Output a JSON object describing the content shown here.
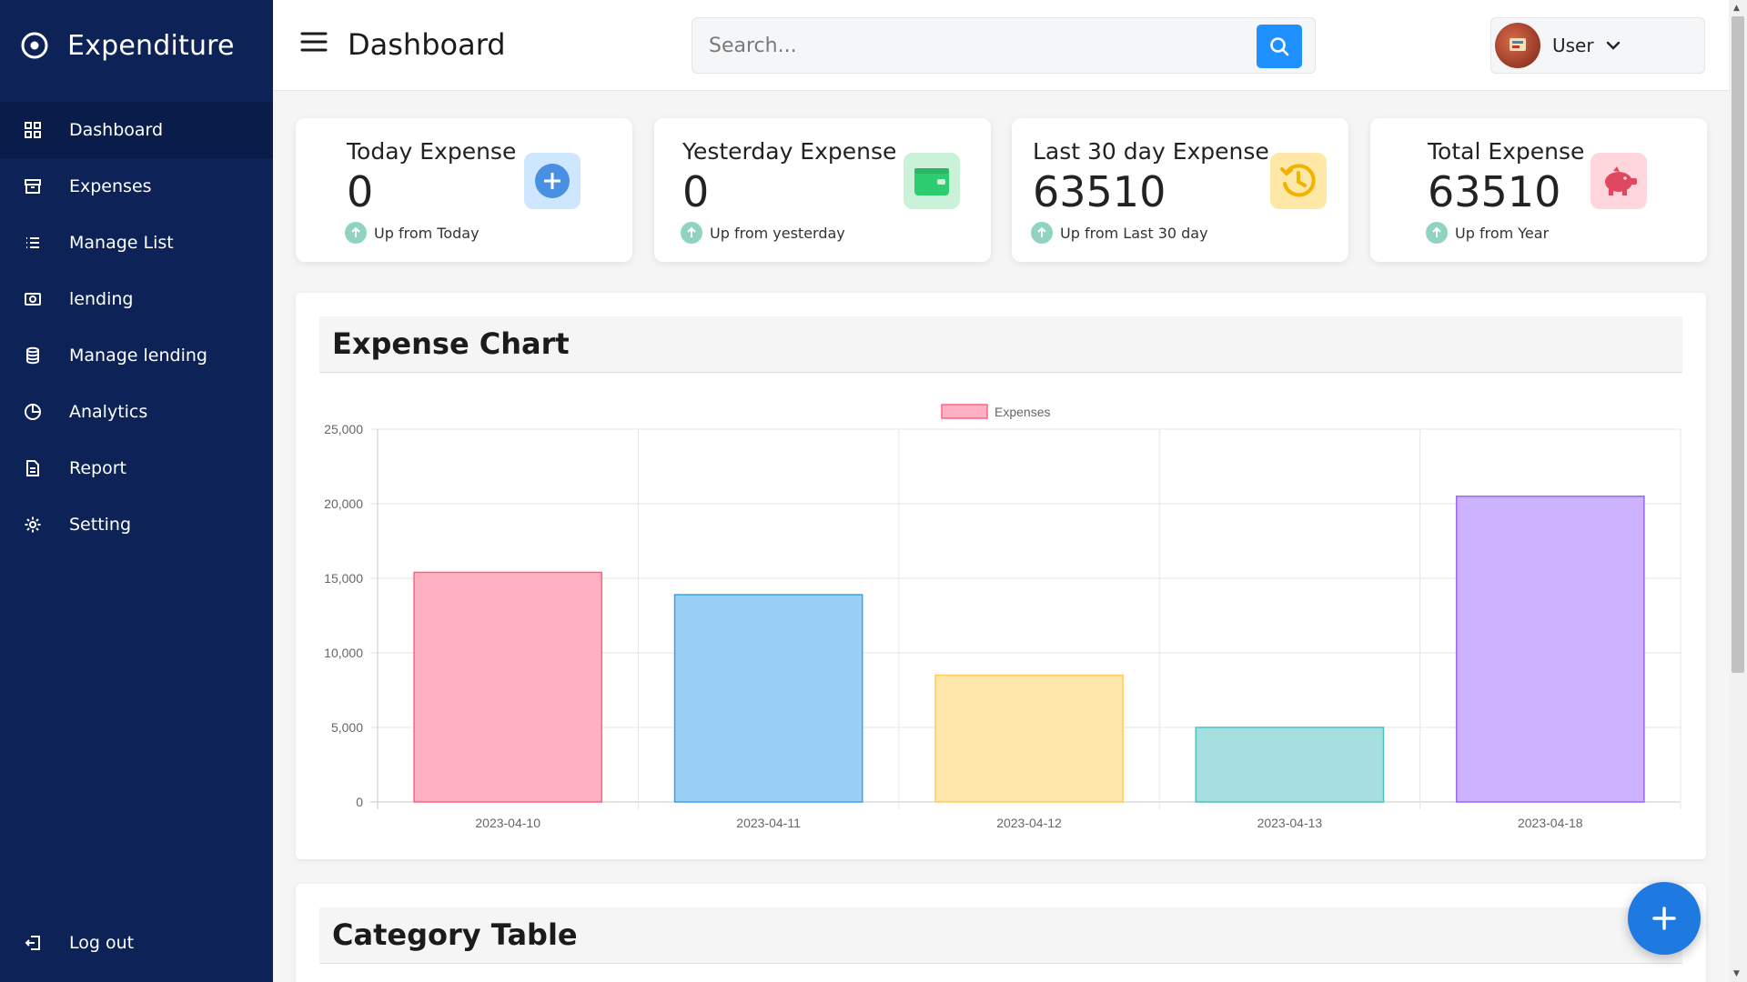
{
  "app": {
    "brand": "Expenditure"
  },
  "sidebar": {
    "items": [
      {
        "label": "Dashboard",
        "icon": "grid-icon",
        "active": true
      },
      {
        "label": "Expenses",
        "icon": "archive-icon"
      },
      {
        "label": "Manage List",
        "icon": "list-icon"
      },
      {
        "label": "lending",
        "icon": "money-icon"
      },
      {
        "label": "Manage lending",
        "icon": "database-icon"
      },
      {
        "label": "Analytics",
        "icon": "pie-chart-icon"
      },
      {
        "label": "Report",
        "icon": "file-icon"
      },
      {
        "label": "Setting",
        "icon": "gear-icon"
      }
    ],
    "logout": "Log out"
  },
  "header": {
    "title": "Dashboard",
    "search_placeholder": "Search...",
    "user_name": "User"
  },
  "cards": [
    {
      "title": "Today Expense",
      "value": "0",
      "footer": "Up from Today",
      "icon": "plus-circle-icon",
      "icon_bg": "#cfe6ff",
      "icon_color": "#4a90e2"
    },
    {
      "title": "Yesterday Expense",
      "value": "0",
      "footer": "Up from yesterday",
      "icon": "wallet-icon",
      "icon_bg": "#c9f2d8",
      "icon_color": "#2ecc71"
    },
    {
      "title": "Last 30 day Expense",
      "value": "63510",
      "footer": "Up from Last 30 day",
      "icon": "history-icon",
      "icon_bg": "#ffe7a8",
      "icon_color": "#f0b400"
    },
    {
      "title": "Total Expense",
      "value": "63510",
      "footer": "Up from Year",
      "icon": "piggy-bank-icon",
      "icon_bg": "#ffd6dc",
      "icon_color": "#e0485f"
    }
  ],
  "expense_panel": {
    "title": "Expense Chart"
  },
  "category_panel": {
    "title": "Category Table"
  },
  "chart_data": {
    "type": "bar",
    "title": "",
    "xlabel": "",
    "ylabel": "",
    "categories": [
      "2023-04-10",
      "2023-04-11",
      "2023-04-12",
      "2023-04-13",
      "2023-04-18"
    ],
    "series": [
      {
        "name": "Expenses",
        "values": [
          15400,
          13900,
          8500,
          5000,
          20500
        ]
      }
    ],
    "bar_fill": [
      "#ffb1c1",
      "#9ad0f5",
      "#ffe6aa",
      "#a5dfdf",
      "#ccb2ff"
    ],
    "bar_stroke": [
      "#ff6384",
      "#36a2eb",
      "#ffcd56",
      "#4bc0c0",
      "#9966ff"
    ],
    "ylim": [
      0,
      25000
    ],
    "yticks": [
      "0",
      "5,000",
      "10,000",
      "15,000",
      "20,000",
      "25,000"
    ],
    "ytick_values": [
      0,
      5000,
      10000,
      15000,
      20000,
      25000
    ],
    "legend": "top-center",
    "grid": true
  }
}
